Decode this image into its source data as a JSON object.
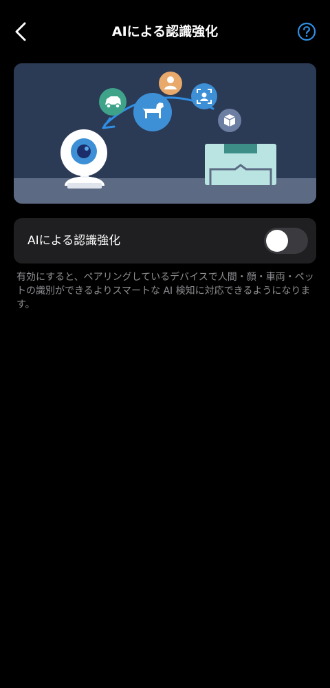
{
  "header": {
    "title": "AIによる認識強化",
    "back_icon": "chevron-left-icon",
    "help_icon": "question-circle-icon"
  },
  "banner": {
    "icons": [
      "person-icon",
      "car-icon",
      "dog-icon",
      "face-scan-icon",
      "package-icon",
      "camera-icon",
      "arrow-icon"
    ]
  },
  "setting": {
    "label": "AIによる認識強化",
    "toggle_on": false
  },
  "description": "有効にすると、ペアリングしているデバイスで人間・顔・車両・ペットの識別ができるよりスマートな AI 検知に対応できるようになります。",
  "colors": {
    "background": "#000000",
    "card": "#1f1f21",
    "accent": "#2f8fe6",
    "toggle_off": "#3b3b3f",
    "text_secondary": "#8e8e93"
  }
}
